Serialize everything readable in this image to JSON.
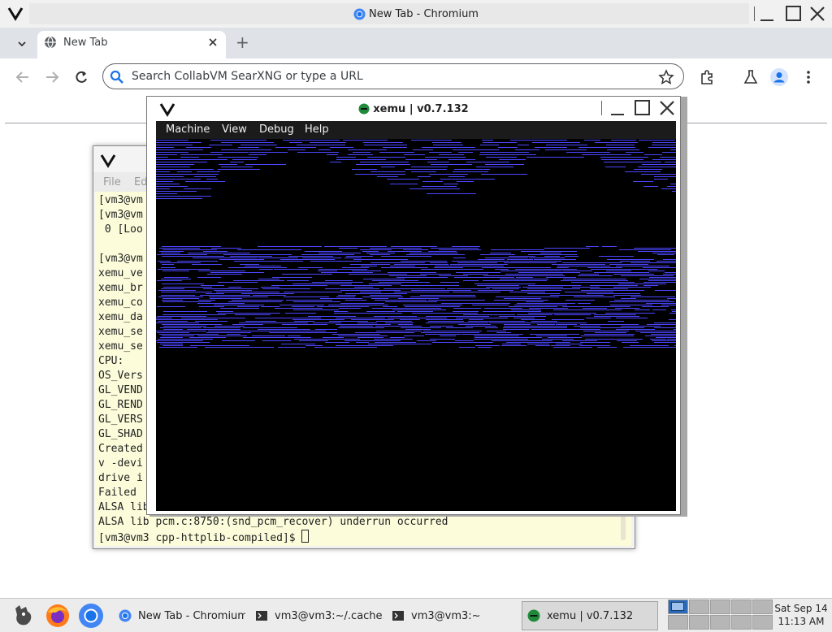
{
  "chromium": {
    "window_title": "New Tab - Chromium",
    "tab_title": "New Tab",
    "new_tab_symbol": "+",
    "omnibox_placeholder": "Search CollabVM SearXNG or type a URL",
    "icons": [
      "window-menu-icon",
      "chromium-icon",
      "minimize-icon",
      "maximize-icon",
      "close-icon",
      "tab-list-icon",
      "globe-icon",
      "tab-close-icon",
      "new-tab-icon",
      "back-icon",
      "forward-icon",
      "reload-icon",
      "search-icon",
      "bookmark-star-icon",
      "extensions-icon",
      "labs-flask-icon",
      "profile-icon",
      "kebab-menu-icon"
    ]
  },
  "terminal": {
    "menu": [
      "File",
      "Ed"
    ],
    "lines": [
      "[vm3@vm",
      "[vm3@vm",
      " 0 [Loo",
      "",
      "[vm3@vm",
      "xemu_ve",
      "xemu_br",
      "xemu_co",
      "xemu_da",
      "xemu_se",
      "xemu_se",
      "CPU:",
      "OS_Vers",
      "GL_VEND",
      "GL_REND",
      "GL_VERS",
      "GL_SHAD",
      "Created",
      "v -devi",
      "drive i",
      "Failed ",
      "ALSA lib",
      "ALSA lib pcm.c:8750:(snd_pcm_recover) underrun occurred"
    ],
    "prompt": "[vm3@vm3 cpp-httplib-compiled]$ "
  },
  "xemu": {
    "window_title": "xemu | v0.7.132",
    "menu": [
      "Machine",
      "View",
      "Debug",
      "Help"
    ],
    "accent": "#4b46ff"
  },
  "taskbar": {
    "tasks": [
      {
        "label": "New Tab - Chromium",
        "icon": "chromium-icon"
      },
      {
        "label": "vm3@vm3:~/.cache...",
        "icon": "terminal-icon"
      },
      {
        "label": "vm3@vm3:~",
        "icon": "terminal-icon"
      },
      {
        "label": "xemu | v0.7.132",
        "icon": "xemu-icon"
      }
    ],
    "launchers": [
      "gimp-icon",
      "firefox-icon",
      "chromium-icon"
    ],
    "clock": {
      "date": "Sat Sep 14",
      "time": "11:13 AM"
    }
  }
}
